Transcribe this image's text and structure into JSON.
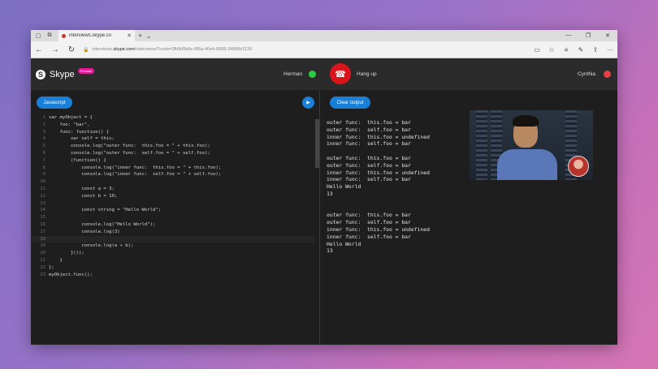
{
  "browser": {
    "tab_title": "interviews.skype.co",
    "url_prefix": "interviews.",
    "url_domain": "skype.com",
    "url_rest": "/interviews/?code=3fb9d5b6e-f86a-40e4-8908-24f6f6d1130",
    "icons": [
      "page-icon",
      "tabs-icon",
      "close-icon",
      "plus-icon",
      "chevron-down-icon",
      "minimize-icon",
      "restore-icon",
      "close-window-icon",
      "back-icon",
      "forward-icon",
      "refresh-icon",
      "lock-icon",
      "reading-view-icon",
      "star-icon",
      "hub-icon",
      "note-icon",
      "share-icon",
      "more-icon"
    ]
  },
  "skype": {
    "brand": "Skype",
    "badge": "Preview",
    "left_user": "Herman",
    "hangup_label": "Hang up",
    "right_user": "Cynthia",
    "colors": {
      "online": "#2ecc40",
      "hangup": "#d9141a",
      "busy": "#e83e45",
      "accent": "#1a7fd6",
      "badge": "#e6189a"
    }
  },
  "editor": {
    "language_button": "Javascript",
    "lines": [
      {
        "n": "1",
        "t": "var myObject = {"
      },
      {
        "n": "2",
        "t": "    foo: \"bar\","
      },
      {
        "n": "3",
        "t": "    func: function() {"
      },
      {
        "n": "4",
        "t": "        var self = this;"
      },
      {
        "n": "5",
        "t": "        console.log(\"outer func:  this.foo = \" + this.foo);"
      },
      {
        "n": "6",
        "t": "        console.log(\"outer func:  self.foo = \" + self.foo);"
      },
      {
        "n": "7",
        "t": "        (function() {"
      },
      {
        "n": "8",
        "t": "            console.log(\"inner func:  this.foo = \" + this.foo);"
      },
      {
        "n": "9",
        "t": "            console.log(\"inner func:  self.foo = \" + self.foo);"
      },
      {
        "n": "10",
        "t": ""
      },
      {
        "n": "11",
        "t": "            const a = 3;"
      },
      {
        "n": "12",
        "t": "            const b = 10;"
      },
      {
        "n": "13",
        "t": ""
      },
      {
        "n": "14",
        "t": "            const string = \"Hello World\";"
      },
      {
        "n": "15",
        "t": ""
      },
      {
        "n": "16",
        "t": "            console.log(\"Hello World\");"
      },
      {
        "n": "17",
        "t": "            console.log(3)"
      },
      {
        "n": "18",
        "t": ""
      },
      {
        "n": "19",
        "t": "            console.log(a + b);"
      },
      {
        "n": "20",
        "t": "        }());"
      },
      {
        "n": "21",
        "t": "    }"
      },
      {
        "n": "22",
        "t": "};"
      },
      {
        "n": "23",
        "t": "myObject.func();"
      }
    ]
  },
  "output": {
    "clear_button": "Clear output",
    "lines": [
      "outer func:  this.foo = bar",
      "outer func:  self.foo = bar",
      "inner func:  this.foo = undefined",
      "inner func:  self.foo = bar",
      "",
      "outer func:  this.foo = bar",
      "outer func:  self.foo = bar",
      "inner func:  this.foo = undefined",
      "inner func:  self.foo = bar",
      "Hello World",
      "13",
      "",
      "",
      "outer func:  this.foo = bar",
      "outer func:  self.foo = bar",
      "inner func:  this.foo = undefined",
      "inner func:  self.foo = bar",
      "Hello World",
      "13"
    ]
  }
}
